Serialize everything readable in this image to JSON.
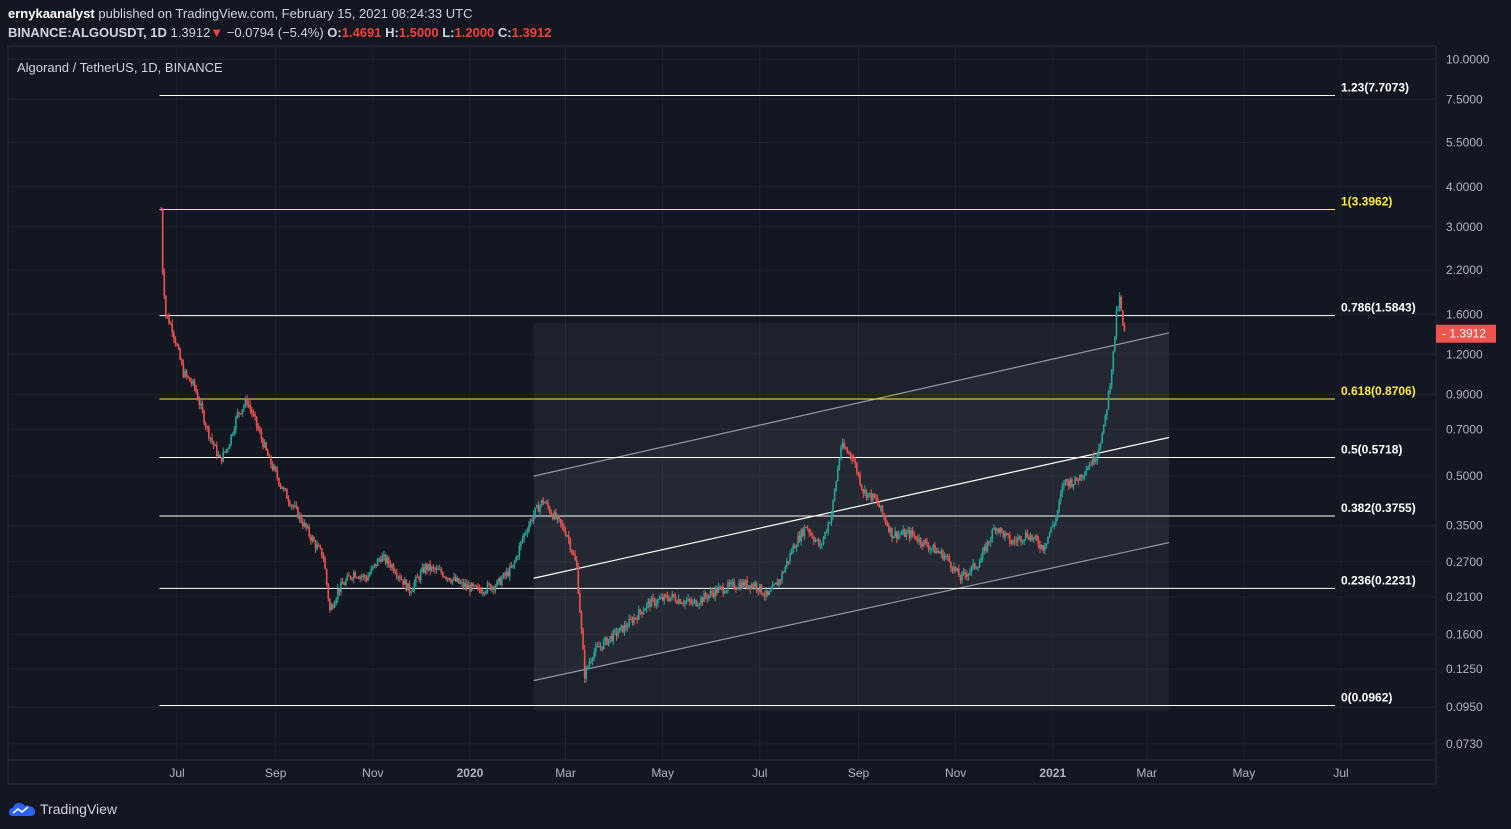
{
  "header": {
    "author": "ernykaanalyst",
    "published": "published on TradingView.com, February 15, 2021 08:24:33 UTC",
    "symbol": "BINANCE:ALGOUSDT, 1D",
    "last": "1.3912",
    "change": "−0.0794 (−5.4%)",
    "open_label": "O:",
    "open": "1.4691",
    "high_label": "H:",
    "high": "1.5000",
    "low_label": "L:",
    "low": "1.2000",
    "close_label": "C:",
    "close": "1.3912"
  },
  "colors": {
    "background": "#131722",
    "up": "#26a69a",
    "down": "#ef5350",
    "fib_white": "#ffffff",
    "fib_yellow": "#ffeb3b",
    "price_badge": "#ef5350"
  },
  "footer": {
    "brand": "TradingView",
    "logo_icon": "tradingview-cloud-icon"
  },
  "chart_data": {
    "type": "candlestick",
    "title": "Algorand / TetherUS, 1D, BINANCE",
    "yscale": "log",
    "ylim": [
      0.065,
      11.0
    ],
    "y_ticks": [
      "10.0000",
      "7.5000",
      "5.5000",
      "4.0000",
      "3.0000",
      "2.2000",
      "1.6000",
      "1.2000",
      "0.9000",
      "0.7000",
      "0.5000",
      "0.3500",
      "0.2700",
      "0.2100",
      "0.1600",
      "0.1250",
      "0.0950",
      "0.0730"
    ],
    "x_ticks": [
      {
        "label": "Jul",
        "date": "2019-07-01"
      },
      {
        "label": "Sep",
        "date": "2019-09-01"
      },
      {
        "label": "Nov",
        "date": "2019-11-01"
      },
      {
        "label": "2020",
        "date": "2020-01-01",
        "bold": true
      },
      {
        "label": "Mar",
        "date": "2020-03-01"
      },
      {
        "label": "May",
        "date": "2020-05-01"
      },
      {
        "label": "Jul",
        "date": "2020-07-01"
      },
      {
        "label": "Sep",
        "date": "2020-09-01"
      },
      {
        "label": "Nov",
        "date": "2020-11-01"
      },
      {
        "label": "2021",
        "date": "2021-01-01",
        "bold": true
      },
      {
        "label": "Mar",
        "date": "2021-03-01"
      },
      {
        "label": "May",
        "date": "2021-05-01"
      },
      {
        "label": "Jul",
        "date": "2021-07-01"
      }
    ],
    "price_path": [
      [
        "2019-06-21",
        3.39
      ],
      [
        "2019-06-22",
        2.2
      ],
      [
        "2019-06-24",
        1.6
      ],
      [
        "2019-06-28",
        1.45
      ],
      [
        "2019-07-05",
        1.05
      ],
      [
        "2019-07-12",
        0.95
      ],
      [
        "2019-07-20",
        0.7
      ],
      [
        "2019-07-28",
        0.56
      ],
      [
        "2019-08-02",
        0.62
      ],
      [
        "2019-08-08",
        0.78
      ],
      [
        "2019-08-14",
        0.86
      ],
      [
        "2019-08-20",
        0.72
      ],
      [
        "2019-08-28",
        0.56
      ],
      [
        "2019-09-06",
        0.45
      ],
      [
        "2019-09-15",
        0.38
      ],
      [
        "2019-09-25",
        0.31
      ],
      [
        "2019-10-01",
        0.28
      ],
      [
        "2019-10-05",
        0.19
      ],
      [
        "2019-10-10",
        0.22
      ],
      [
        "2019-10-20",
        0.25
      ],
      [
        "2019-10-28",
        0.24
      ],
      [
        "2019-11-06",
        0.28
      ],
      [
        "2019-11-14",
        0.26
      ],
      [
        "2019-11-24",
        0.22
      ],
      [
        "2019-12-04",
        0.26
      ],
      [
        "2019-12-14",
        0.25
      ],
      [
        "2019-12-26",
        0.23
      ],
      [
        "2020-01-06",
        0.22
      ],
      [
        "2020-01-18",
        0.23
      ],
      [
        "2020-01-28",
        0.26
      ],
      [
        "2020-02-04",
        0.33
      ],
      [
        "2020-02-10",
        0.38
      ],
      [
        "2020-02-16",
        0.42
      ],
      [
        "2020-02-22",
        0.38
      ],
      [
        "2020-03-02",
        0.33
      ],
      [
        "2020-03-08",
        0.26
      ],
      [
        "2020-03-13",
        0.12
      ],
      [
        "2020-03-18",
        0.14
      ],
      [
        "2020-03-28",
        0.155
      ],
      [
        "2020-04-08",
        0.17
      ],
      [
        "2020-04-22",
        0.2
      ],
      [
        "2020-05-06",
        0.21
      ],
      [
        "2020-05-20",
        0.2
      ],
      [
        "2020-06-04",
        0.22
      ],
      [
        "2020-06-18",
        0.23
      ],
      [
        "2020-06-28",
        0.23
      ],
      [
        "2020-07-06",
        0.21
      ],
      [
        "2020-07-14",
        0.24
      ],
      [
        "2020-07-22",
        0.3
      ],
      [
        "2020-07-30",
        0.35
      ],
      [
        "2020-08-08",
        0.3
      ],
      [
        "2020-08-15",
        0.38
      ],
      [
        "2020-08-21",
        0.62
      ],
      [
        "2020-08-28",
        0.58
      ],
      [
        "2020-09-04",
        0.45
      ],
      [
        "2020-09-12",
        0.42
      ],
      [
        "2020-09-22",
        0.33
      ],
      [
        "2020-10-04",
        0.33
      ],
      [
        "2020-10-16",
        0.3
      ],
      [
        "2020-10-26",
        0.28
      ],
      [
        "2020-11-04",
        0.24
      ],
      [
        "2020-11-16",
        0.27
      ],
      [
        "2020-11-26",
        0.35
      ],
      [
        "2020-12-06",
        0.31
      ],
      [
        "2020-12-16",
        0.33
      ],
      [
        "2020-12-26",
        0.3
      ],
      [
        "2021-01-03",
        0.37
      ],
      [
        "2021-01-08",
        0.48
      ],
      [
        "2021-01-15",
        0.48
      ],
      [
        "2021-01-22",
        0.53
      ],
      [
        "2021-01-28",
        0.58
      ],
      [
        "2021-02-02",
        0.7
      ],
      [
        "2021-02-05",
        0.9
      ],
      [
        "2021-02-08",
        1.2
      ],
      [
        "2021-02-10",
        1.6
      ],
      [
        "2021-02-12",
        1.78
      ],
      [
        "2021-02-14",
        1.47
      ],
      [
        "2021-02-15",
        1.39
      ]
    ],
    "fib_levels": [
      {
        "ratio": "1.23",
        "price": 7.7073,
        "label": "1.23(7.7073)",
        "color": "white"
      },
      {
        "ratio": "1",
        "price": 3.3962,
        "label": "1(3.3962)",
        "color": "yellow"
      },
      {
        "ratio": "0.786",
        "price": 1.5843,
        "label": "0.786(1.5843)",
        "color": "white"
      },
      {
        "ratio": "0.618",
        "price": 0.8706,
        "label": "0.618(0.8706)",
        "color": "yellow"
      },
      {
        "ratio": "0.5",
        "price": 0.5718,
        "label": "0.5(0.5718)",
        "color": "white"
      },
      {
        "ratio": "0.382",
        "price": 0.3755,
        "label": "0.382(0.3755)",
        "color": "white"
      },
      {
        "ratio": "0.236",
        "price": 0.2231,
        "label": "0.236(0.2231)",
        "color": "white"
      },
      {
        "ratio": "0",
        "price": 0.0962,
        "label": "0(0.0962)",
        "color": "white"
      }
    ],
    "fib_start_date": "2019-06-20",
    "channel": {
      "start_date": "2020-02-10",
      "end_date": "2021-03-15",
      "upper": [
        0.5,
        1.4
      ],
      "middle": [
        0.24,
        0.66
      ],
      "lower": [
        0.115,
        0.31
      ]
    },
    "last_price_label": "1.3912"
  }
}
